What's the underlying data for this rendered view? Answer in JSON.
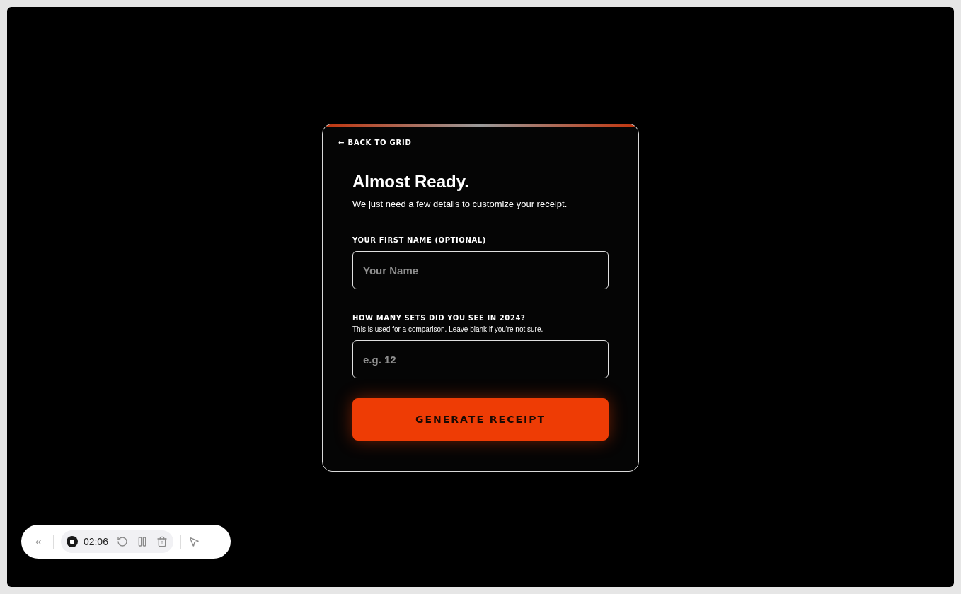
{
  "back_link": {
    "label": "← BACK TO GRID"
  },
  "title": "Almost Ready.",
  "subtitle": "We just need a few details to customize your receipt.",
  "fields": [
    {
      "label": "YOUR FIRST NAME (OPTIONAL)",
      "placeholder": "Your Name"
    },
    {
      "label": "HOW MANY SETS DID YOU SEE IN 2024?",
      "hint": "This is used for a comparison. Leave blank if you're not sure.",
      "placeholder": "e.g. 12"
    }
  ],
  "submit_button": {
    "label": "GENERATE RECEIPT"
  },
  "recorder": {
    "collapse": "«",
    "time": "02:06",
    "paused": false
  }
}
